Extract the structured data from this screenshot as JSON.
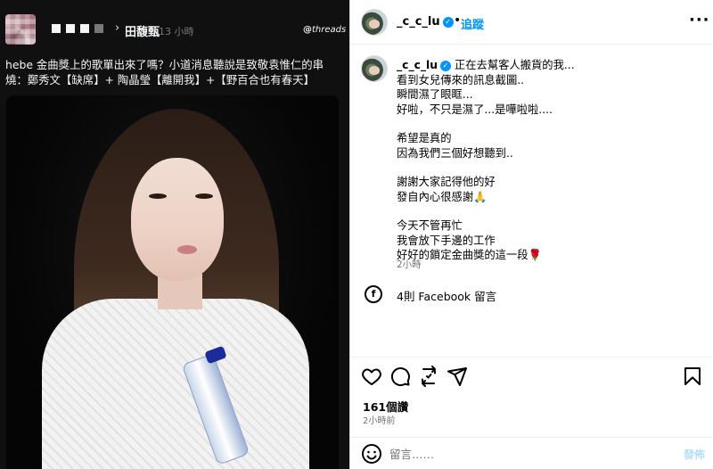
{
  "threads": {
    "author_name": "田馥甄",
    "time": "13 小時",
    "brand": "threads",
    "post_text": "hebe 金曲獎上的歌單出來了嗎？小道消息聽說是致敬袁惟仁的串燒：鄭秀文【缺席】+ 陶晶瑩【離開我】+【野百合也有春天】",
    "icons": [
      "chevron-right-icon",
      "threads-logo-icon"
    ]
  },
  "instagram": {
    "username": "_c_c_lu",
    "follow_label": "追蹤",
    "more_label": "···",
    "caption_username": "_c_c_lu",
    "caption_lines": [
      "正在去幫客人搬貨的我...",
      "看到女兒傳來的訊息截圖..",
      "瞬間濕了眼眶...",
      "好啦，不只是濕了...是嘩啦啦....",
      "",
      "希望是真的",
      "因為我們三個好想聽到..",
      "",
      "謝謝大家記得他的好",
      "發自內心很感謝🙏",
      "",
      "今天不管再忙",
      "我會放下手邊的工作",
      "好好的鎖定金曲獎的這一段🌹"
    ],
    "caption_time": "2小時",
    "facebook_comments": "4則 Facebook 留言",
    "likes": "161個讚",
    "posted_ago": "2小時前",
    "comment_placeholder": "留言……",
    "post_label": "發佈",
    "colors": {
      "accent": "#0095f6",
      "post_disabled": "#b2dffc",
      "meta": "#737373"
    },
    "icons": [
      "verified-badge-icon",
      "facebook-icon",
      "heart-icon",
      "comment-icon",
      "share-icon",
      "send-icon",
      "bookmark-icon",
      "emoji-icon"
    ]
  }
}
